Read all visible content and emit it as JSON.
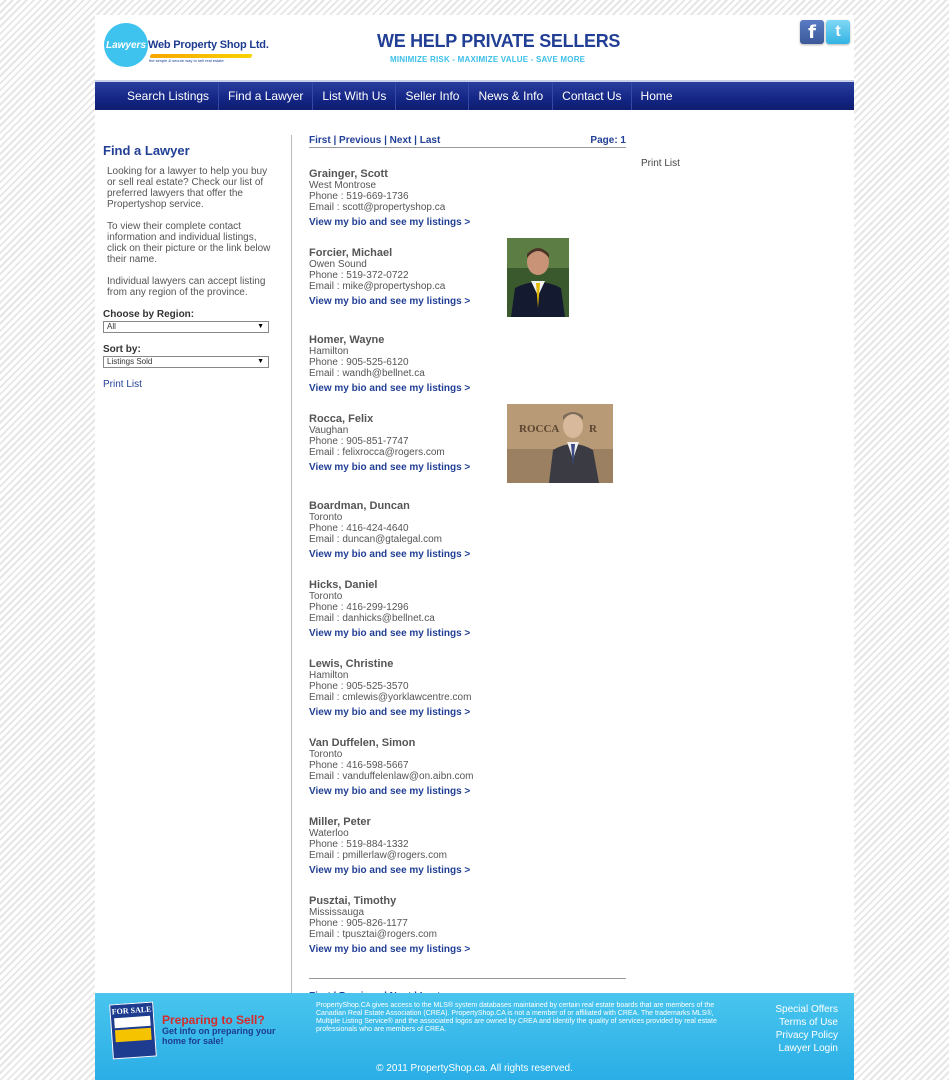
{
  "header": {
    "logo_circle": "Lawyers",
    "logo_name": "Web Property Shop Ltd.",
    "logo_tagline": "the simple & secure way to sell real estate",
    "tagline_main": "WE HELP PRIVATE SELLERS",
    "tagline_sub": "MINIMIZE RISK - MAXIMIZE VALUE - SAVE MORE",
    "facebook_icon": "f",
    "twitter_icon": "t"
  },
  "nav": [
    "Search Listings",
    "Find a Lawyer",
    "List With Us",
    "Seller Info",
    "News & Info",
    "Contact Us",
    "Home"
  ],
  "sidebar": {
    "title": "Find a Lawyer",
    "para1": "Looking for a lawyer to help you buy or sell real estate? Check our list of preferred lawyers that offer the Propertyshop service.",
    "para2": "To view their complete contact information and individual listings, click on their picture or the link below their name.",
    "para3": "Individual lawyers can accept listing from any region of the province.",
    "region_label": "Choose by Region:",
    "region_value": "All",
    "sort_label": "Sort by:",
    "sort_value": "Listings Sold",
    "print": "Print List"
  },
  "pager": {
    "first": "First",
    "previous": "Previous",
    "next": "Next",
    "last": "Last",
    "sep": "|",
    "page": "Page: 1"
  },
  "print_right": "Print List",
  "bio_link": "View my bio and see my listings >",
  "lawyers": [
    {
      "name": "Grainger, Scott",
      "city": "West Montrose",
      "phone": "Phone : 519-669-1736",
      "email": "Email : scott@propertyshop.ca"
    },
    {
      "name": "Forcier, Michael",
      "city": "Owen Sound",
      "phone": "Phone : 519-372-0722",
      "email": "Email : mike@propertyshop.ca"
    },
    {
      "name": "Homer, Wayne",
      "city": "Hamilton",
      "phone": "Phone : 905-525-6120",
      "email": "Email : wandh@bellnet.ca"
    },
    {
      "name": "Rocca, Felix",
      "city": "Vaughan",
      "phone": "Phone : 905-851-7747",
      "email": "Email : felixrocca@rogers.com"
    },
    {
      "name": "Boardman, Duncan",
      "city": "Toronto",
      "phone": "Phone : 416-424-4640",
      "email": "Email : duncan@gtalegal.com"
    },
    {
      "name": "Hicks, Daniel",
      "city": "Toronto",
      "phone": "Phone : 416-299-1296",
      "email": "Email : danhicks@bellnet.ca"
    },
    {
      "name": "Lewis, Christine",
      "city": "Hamilton",
      "phone": "Phone : 905-525-3570",
      "email": "Email : cmlewis@yorklawcentre.com"
    },
    {
      "name": "Van Duffelen, Simon",
      "city": "Toronto",
      "phone": "Phone : 416-598-5667",
      "email": "Email : vanduffelenlaw@on.aibn.com"
    },
    {
      "name": "Miller, Peter",
      "city": "Waterloo",
      "phone": "Phone : 519-884-1332",
      "email": "Email : pmillerlaw@rogers.com"
    },
    {
      "name": "Pusztai, Timothy",
      "city": "Mississauga",
      "phone": "Phone : 905-826-1177",
      "email": "Email : tpusztai@rogers.com"
    }
  ],
  "footer": {
    "forsale": "FOR SALE",
    "prep_title": "Preparing to Sell?",
    "prep_sub": "Get info on preparing your home for sale!",
    "disclaimer": "PropertyShop.CA gives access to the MLS® system databases maintained by certain real estate boards that are members of the Canadian Real Estate Association (CREA). PropertyShop.CA is not a member of or affiliated with CREA. The trademarks MLS®, Multiple Listing Service® and the associated logos are owned by CREA and identify the quality of services provided by real estate professionals who are members of CREA.",
    "links": [
      "Special Offers",
      "Terms of Use",
      "Privacy Policy",
      "Lawyer Login"
    ],
    "copyright": "© 2011 PropertyShop.ca. All rights reserved."
  }
}
